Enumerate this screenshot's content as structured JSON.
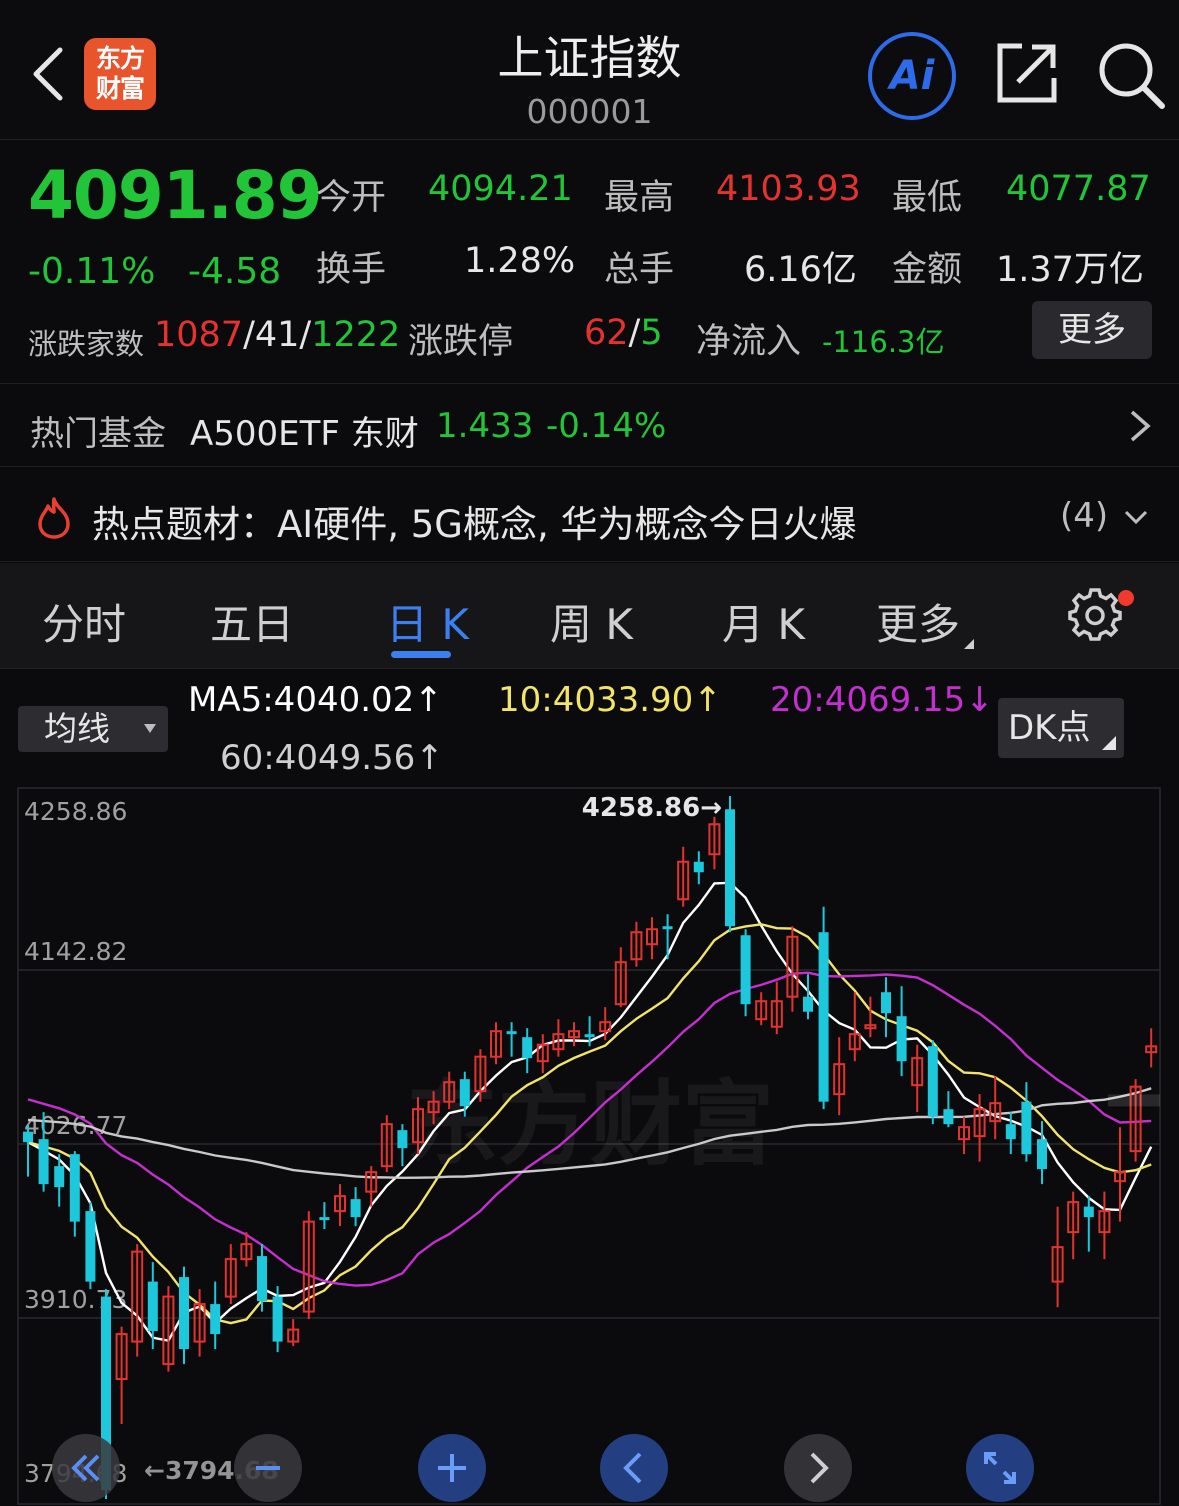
{
  "header": {
    "title": "上证指数",
    "code": "000001",
    "logo_line1": "东方",
    "logo_line2": "财富",
    "ai_label": "Ai"
  },
  "quote": {
    "price": "4091.89",
    "change_pct": "-0.11%",
    "change_abs": "-4.58",
    "open_label": "今开",
    "open": "4094.21",
    "high_label": "最高",
    "high": "4103.93",
    "low_label": "最低",
    "low": "4077.87",
    "turnover_label": "换手",
    "turnover": "1.28%",
    "volume_label": "总手",
    "volume": "6.16亿",
    "amount_label": "金额",
    "amount": "1.37万亿",
    "breadth_label": "涨跌家数",
    "breadth_up": "1087",
    "breadth_flat": "41",
    "breadth_down": "1222",
    "limit_label": "涨跌停",
    "limit_up": "62",
    "limit_down": "5",
    "inflow_label": "净流入",
    "inflow": "-116.3亿",
    "more_label": "更多",
    "slash": "/"
  },
  "fund": {
    "label": "热门基金",
    "name": "A500ETF 东财",
    "price": "1.433",
    "change": "-0.14%"
  },
  "hot": {
    "text": "热点题材：AI硬件, 5G概念, 华为概念今日火爆",
    "count": "(4)"
  },
  "tabs": {
    "items": [
      "分时",
      "五日",
      "日 K",
      "周 K",
      "月 K",
      "更多"
    ],
    "active": 2
  },
  "ma": {
    "select_label": "均线",
    "ma5": "MA5:4040.02",
    "ma10": "10:4033.90",
    "ma20": "20:4069.15",
    "ma60": "60:4049.56",
    "up_arrow": "↑",
    "down_arrow": "↓",
    "dk_label": "DK点"
  },
  "colors": {
    "up": "#e4332f",
    "down": "#1ec8dc",
    "ma5": "#ffffff",
    "ma10": "#f2e36b",
    "ma20": "#c42fd0",
    "ma60": "#c9c9c9",
    "accent": "#3d7ef0",
    "green": "#22c538"
  },
  "chart_data": {
    "type": "candlestick",
    "y_labels": [
      "4258.86",
      "4142.82",
      "4026.77",
      "3910.73",
      "3794.68"
    ],
    "ylim": [
      3794.68,
      4258.86
    ],
    "max_annotation": "4258.86",
    "min_annotation": "3794.68",
    "watermark": "东方财富",
    "candles": [
      {
        "o": 4035,
        "c": 4028,
        "h": 4040,
        "l": 4005
      },
      {
        "o": 4030,
        "c": 4000,
        "h": 4048,
        "l": 3995
      },
      {
        "o": 4012,
        "c": 3998,
        "h": 4020,
        "l": 3985
      },
      {
        "o": 4020,
        "c": 3975,
        "h": 4022,
        "l": 3965
      },
      {
        "o": 3982,
        "c": 3935,
        "h": 3988,
        "l": 3930
      },
      {
        "o": 3925,
        "c": 3796,
        "h": 3930,
        "l": 3790
      },
      {
        "o": 3870,
        "c": 3900,
        "h": 3905,
        "l": 3840
      },
      {
        "o": 3895,
        "c": 3955,
        "h": 3960,
        "l": 3885
      },
      {
        "o": 3935,
        "c": 3902,
        "h": 3948,
        "l": 3890
      },
      {
        "o": 3880,
        "c": 3925,
        "h": 3932,
        "l": 3875
      },
      {
        "o": 3938,
        "c": 3890,
        "h": 3945,
        "l": 3880
      },
      {
        "o": 3895,
        "c": 3920,
        "h": 3930,
        "l": 3885
      },
      {
        "o": 3920,
        "c": 3900,
        "h": 3935,
        "l": 3890
      },
      {
        "o": 3925,
        "c": 3950,
        "h": 3960,
        "l": 3920
      },
      {
        "o": 3950,
        "c": 3960,
        "h": 3968,
        "l": 3945
      },
      {
        "o": 3952,
        "c": 3922,
        "h": 3960,
        "l": 3915
      },
      {
        "o": 3925,
        "c": 3895,
        "h": 3932,
        "l": 3888
      },
      {
        "o": 3895,
        "c": 3903,
        "h": 3910,
        "l": 3892
      },
      {
        "o": 3915,
        "c": 3975,
        "h": 3982,
        "l": 3910
      },
      {
        "o": 3978,
        "c": 3976,
        "h": 3988,
        "l": 3970
      },
      {
        "o": 3982,
        "c": 3992,
        "h": 4000,
        "l": 3972
      },
      {
        "o": 3990,
        "c": 3978,
        "h": 3998,
        "l": 3972
      },
      {
        "o": 3995,
        "c": 4008,
        "h": 4012,
        "l": 3985
      },
      {
        "o": 4012,
        "c": 4040,
        "h": 4046,
        "l": 4008
      },
      {
        "o": 4036,
        "c": 4024,
        "h": 4040,
        "l": 4012
      },
      {
        "o": 4028,
        "c": 4050,
        "h": 4058,
        "l": 4020
      },
      {
        "o": 4048,
        "c": 4055,
        "h": 4062,
        "l": 4040
      },
      {
        "o": 4055,
        "c": 4068,
        "h": 4075,
        "l": 4050
      },
      {
        "o": 4070,
        "c": 4052,
        "h": 4075,
        "l": 4045
      },
      {
        "o": 4062,
        "c": 4085,
        "h": 4090,
        "l": 4055
      },
      {
        "o": 4085,
        "c": 4102,
        "h": 4108,
        "l": 4080
      },
      {
        "o": 4102,
        "c": 4100,
        "h": 4108,
        "l": 4085
      },
      {
        "o": 4098,
        "c": 4084,
        "h": 4104,
        "l": 4074
      },
      {
        "o": 4082,
        "c": 4093,
        "h": 4100,
        "l": 4074
      },
      {
        "o": 4090,
        "c": 4100,
        "h": 4110,
        "l": 4085
      },
      {
        "o": 4098,
        "c": 4102,
        "h": 4108,
        "l": 4092
      },
      {
        "o": 4100,
        "c": 4098,
        "h": 4112,
        "l": 4092
      },
      {
        "o": 4102,
        "c": 4108,
        "h": 4118,
        "l": 4096
      },
      {
        "o": 4120,
        "c": 4148,
        "h": 4158,
        "l": 4118
      },
      {
        "o": 4150,
        "c": 4168,
        "h": 4175,
        "l": 4145
      },
      {
        "o": 4160,
        "c": 4170,
        "h": 4178,
        "l": 4150
      },
      {
        "o": 4172,
        "c": 4170,
        "h": 4180,
        "l": 4150
      },
      {
        "o": 4190,
        "c": 4215,
        "h": 4225,
        "l": 4185
      },
      {
        "o": 4215,
        "c": 4208,
        "h": 4222,
        "l": 4200
      },
      {
        "o": 4220,
        "c": 4240,
        "h": 4245,
        "l": 4210
      },
      {
        "o": 4250,
        "c": 4172,
        "h": 4258.86,
        "l": 4168
      },
      {
        "o": 4166,
        "c": 4120,
        "h": 4170,
        "l": 4112
      },
      {
        "o": 4110,
        "c": 4122,
        "h": 4128,
        "l": 4106
      },
      {
        "o": 4105,
        "c": 4122,
        "h": 4135,
        "l": 4100
      },
      {
        "o": 4125,
        "c": 4165,
        "h": 4172,
        "l": 4115
      },
      {
        "o": 4125,
        "c": 4115,
        "h": 4140,
        "l": 4110
      },
      {
        "o": 4168,
        "c": 4055,
        "h": 4185,
        "l": 4050
      },
      {
        "o": 4060,
        "c": 4080,
        "h": 4098,
        "l": 4046
      },
      {
        "o": 4090,
        "c": 4100,
        "h": 4128,
        "l": 4082
      },
      {
        "o": 4104,
        "c": 4106,
        "h": 4125,
        "l": 4098
      },
      {
        "o": 4128,
        "c": 4114,
        "h": 4138,
        "l": 4098
      },
      {
        "o": 4112,
        "c": 4082,
        "h": 4132,
        "l": 4072
      },
      {
        "o": 4066,
        "c": 4084,
        "h": 4093,
        "l": 4048
      },
      {
        "o": 4092,
        "c": 4045,
        "h": 4096,
        "l": 4040
      },
      {
        "o": 4050,
        "c": 4040,
        "h": 4062,
        "l": 4038
      },
      {
        "o": 4030,
        "c": 4038,
        "h": 4045,
        "l": 4020
      },
      {
        "o": 4032,
        "c": 4050,
        "h": 4060,
        "l": 4015
      },
      {
        "o": 4042,
        "c": 4054,
        "h": 4072,
        "l": 4030
      },
      {
        "o": 4040,
        "c": 4030,
        "h": 4048,
        "l": 4020
      },
      {
        "o": 4055,
        "c": 4020,
        "h": 4068,
        "l": 4015
      },
      {
        "o": 4030,
        "c": 4010,
        "h": 4042,
        "l": 4000
      },
      {
        "o": 3935,
        "c": 3958,
        "h": 3985,
        "l": 3918
      },
      {
        "o": 3968,
        "c": 3988,
        "h": 3995,
        "l": 3950
      },
      {
        "o": 3985,
        "c": 3978,
        "h": 3992,
        "l": 3955
      },
      {
        "o": 3968,
        "c": 3982,
        "h": 3995,
        "l": 3950
      },
      {
        "o": 4002,
        "c": 4008,
        "h": 4038,
        "l": 3975
      },
      {
        "o": 4022,
        "c": 4065,
        "h": 4070,
        "l": 4015
      },
      {
        "o": 4088,
        "c": 4091.89,
        "h": 4103.93,
        "l": 4077.87
      }
    ]
  }
}
